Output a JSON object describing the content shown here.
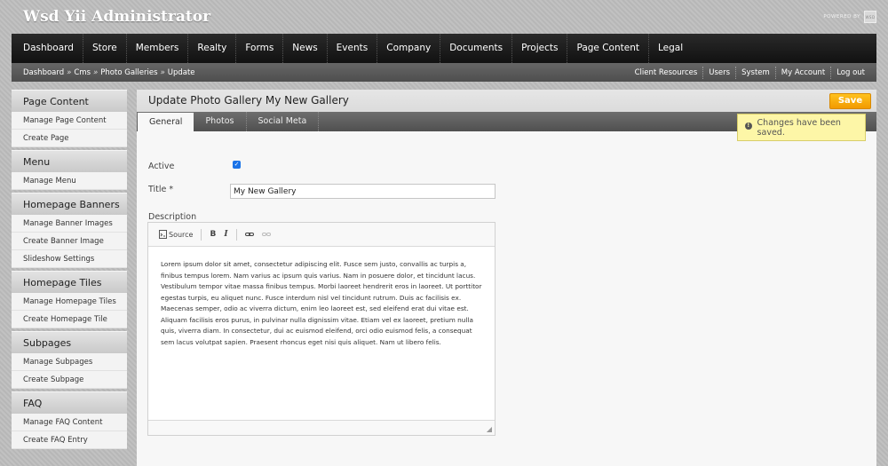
{
  "header": {
    "app_title": "Wsd Yii Administrator",
    "powered_by": "POWERED BY",
    "powered_logo_text": "WSD"
  },
  "main_nav": [
    "Dashboard",
    "Store",
    "Members",
    "Realty",
    "Forms",
    "News",
    "Events",
    "Company",
    "Documents",
    "Projects",
    "Page Content",
    "Legal"
  ],
  "breadcrumb": [
    "Dashboard",
    "Cms",
    "Photo Galleries",
    "Update"
  ],
  "breadcrumb_separator": "»",
  "utility_links": [
    "Client Resources",
    "Users",
    "System",
    "My Account",
    "Log out"
  ],
  "sidebar": [
    {
      "heading": "Page Content",
      "items": [
        "Manage Page Content",
        "Create Page"
      ]
    },
    {
      "heading": "Menu",
      "items": [
        "Manage Menu"
      ]
    },
    {
      "heading": "Homepage Banners",
      "items": [
        "Manage Banner Images",
        "Create Banner Image",
        "Slideshow Settings"
      ]
    },
    {
      "heading": "Homepage Tiles",
      "items": [
        "Manage Homepage Tiles",
        "Create Homepage Tile"
      ]
    },
    {
      "heading": "Subpages",
      "items": [
        "Manage Subpages",
        "Create Subpage"
      ]
    },
    {
      "heading": "FAQ",
      "items": [
        "Manage FAQ Content",
        "Create FAQ Entry"
      ]
    }
  ],
  "content": {
    "page_title": "Update Photo Gallery My New Gallery",
    "save_label": "Save",
    "tabs": [
      "General",
      "Photos",
      "Social Meta"
    ],
    "active_tab": "General",
    "alert_text": "Changes have been saved.",
    "form": {
      "active_label": "Active",
      "active_checked": true,
      "title_label": "Title *",
      "title_value": "My New Gallery",
      "description_label": "Description",
      "toolbar": {
        "source_label": "Source",
        "bold_label": "B",
        "italic_label": "I"
      },
      "description_text": "Lorem ipsum dolor sit amet, consectetur adipiscing elit. Fusce sem justo, convallis ac turpis a, finibus tempus lorem. Nam varius ac ipsum quis varius. Nam in posuere dolor, et tincidunt lacus. Vestibulum tempor vitae massa finibus tempus. Morbi laoreet hendrerit eros in laoreet. Ut porttitor egestas turpis, eu aliquet nunc. Fusce interdum nisl vel tincidunt rutrum. Duis ac facilisis ex. Maecenas semper, odio ac viverra dictum, enim leo laoreet est, sed eleifend erat dui vitae est. Aliquam facilisis eros purus, in pulvinar nulla dignissim vitae. Etiam vel ex laoreet, pretium nulla quis, viverra diam. In consectetur, dui ac euismod eleifend, orci odio euismod felis, a consequat sem lacus volutpat sapien. Praesent rhoncus eget nisi quis aliquet. Nam ut libero felis."
    }
  },
  "colors": {
    "save_button": "#f29a00",
    "alert_bg": "#fdf6a7",
    "nav_bg": "#111111",
    "checkbox": "#1a73e8"
  }
}
